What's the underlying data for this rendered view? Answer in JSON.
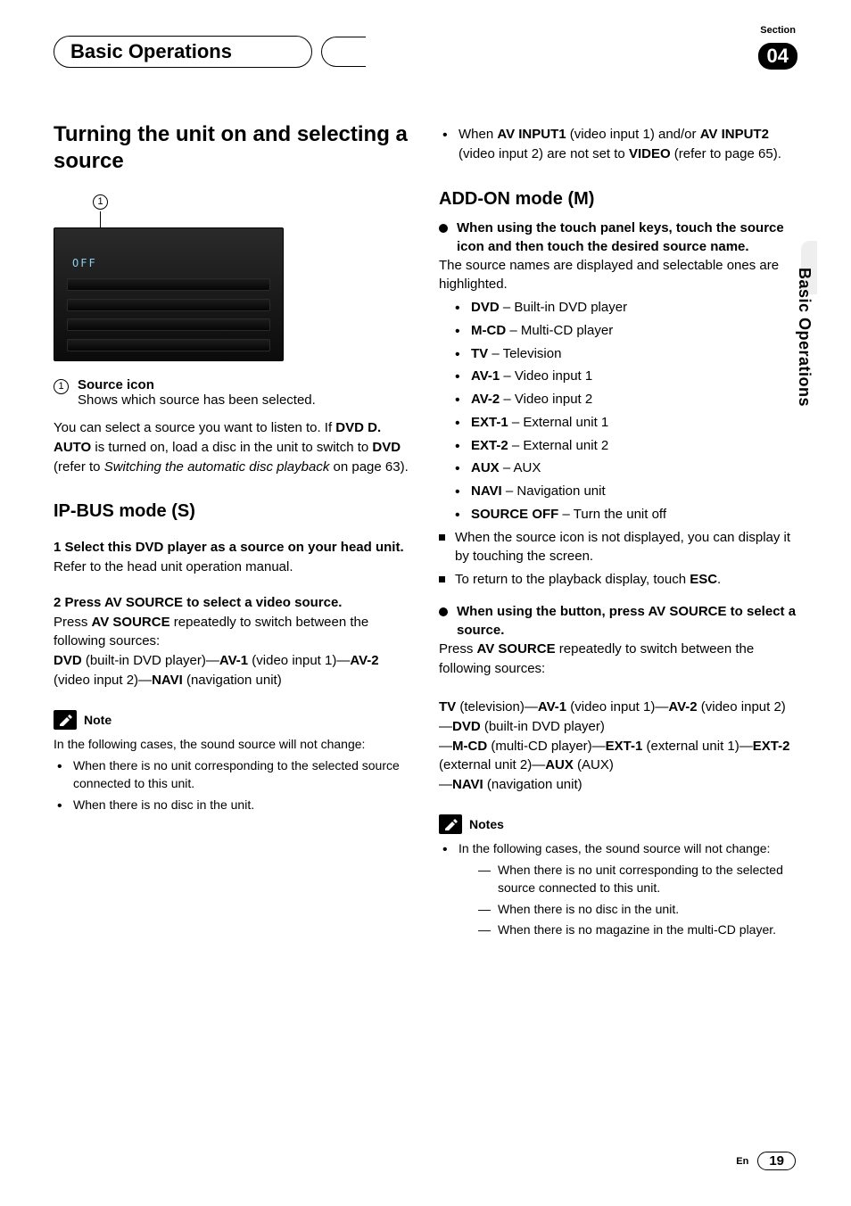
{
  "header": {
    "title": "Basic Operations",
    "section_label": "Section",
    "section_number": "04",
    "side_label": "Basic Operations"
  },
  "left": {
    "h1": "Turning the unit on and selecting a source",
    "callout_number": "1",
    "device_off_text": "OFF",
    "source_icon_label": "Source icon",
    "source_icon_desc": "Shows which source has been selected.",
    "intro_p1a": "You can select a source you want to listen to. If ",
    "intro_p1_bold1": "DVD D. AUTO",
    "intro_p1b": " is turned on, load a disc in the unit to switch to ",
    "intro_p1_bold2": "DVD",
    "intro_p1c": " (refer to ",
    "intro_p1_ital": "Switching the automatic disc playback",
    "intro_p1d": " on page 63).",
    "h2_ipbus": "IP-BUS mode (S)",
    "step1_head": "1    Select this DVD player as a source on your head unit.",
    "step1_body": "Refer to the head unit operation manual.",
    "step2_head": "2    Press AV SOURCE to select a video source.",
    "step2_body_a": "Press ",
    "step2_body_bold": "AV SOURCE",
    "step2_body_b": " repeatedly to switch between the following sources:",
    "seq_a1": "DVD",
    "seq_a1d": " (built-in DVD player)—",
    "seq_a2": "AV-1",
    "seq_a2d": " (video input 1)—",
    "seq_a3": "AV-2",
    "seq_a3d": " (video input 2)—",
    "seq_a4": "NAVI",
    "seq_a4d": " (navigation unit)",
    "note_title": "Note",
    "note_intro": "In the following cases, the sound source will not change:",
    "note_b1": "When there is no unit corresponding to the selected source connected to this unit.",
    "note_b2": "When there is no disc in the unit."
  },
  "right": {
    "top_b1a": "When ",
    "top_b1b": "AV INPUT1",
    "top_b1c": " (video input 1) and/or ",
    "top_b1d": "AV INPUT2",
    "top_b1e": " (video input 2) are not set to ",
    "top_b1f": "VIDEO",
    "top_b1g": " (refer to page 65).",
    "h2_addon": "ADD-ON mode (M)",
    "touch_head": "When using the touch panel keys, touch the source icon and then touch the desired source name.",
    "touch_body": "The source names are displayed and selectable ones are highlighted.",
    "src": [
      {
        "k": "DVD",
        "v": " – Built-in DVD player"
      },
      {
        "k": "M-CD",
        "v": " – Multi-CD player"
      },
      {
        "k": "TV",
        "v": " – Television"
      },
      {
        "k": "AV-1",
        "v": " – Video input 1"
      },
      {
        "k": "AV-2",
        "v": " – Video input 2"
      },
      {
        "k": "EXT-1",
        "v": " – External unit 1"
      },
      {
        "k": "EXT-2",
        "v": " – External unit 2"
      },
      {
        "k": "AUX",
        "v": " – AUX"
      },
      {
        "k": "NAVI",
        "v": " – Navigation unit"
      },
      {
        "k": "SOURCE OFF",
        "v": " – Turn the unit off"
      }
    ],
    "sq1": "When the source icon is not displayed, you can display it by touching the screen.",
    "sq2a": "To return to the playback display, touch ",
    "sq2b": "ESC",
    "sq2c": ".",
    "btn_head": "When using the button, press AV SOURCE to select a source.",
    "btn_body_a": "Press ",
    "btn_body_bold": "AV SOURCE",
    "btn_body_b": " repeatedly to switch between the following sources:",
    "seq_b1": "TV",
    "seq_b1d": " (television)—",
    "seq_b2": "AV-1",
    "seq_b2d": " (video input 1)—",
    "seq_b3": "AV-2",
    "seq_b3d": " (video input 2)—",
    "seq_b4": "DVD",
    "seq_b4d": " (built-in DVD player)\n—",
    "seq_b5": "M-CD",
    "seq_b5d": " (multi-CD player)—",
    "seq_b6": "EXT-1",
    "seq_b6d": " (external unit 1)—",
    "seq_b7": "EXT-2",
    "seq_b7d": " (external unit 2)—",
    "seq_b8": "AUX",
    "seq_b8d": " (AUX)\n—",
    "seq_b9": "NAVI",
    "seq_b9d": " (navigation unit)",
    "notes_title": "Notes",
    "notes_intro": "In the following cases, the sound source will not change:",
    "notes_d1": "When there is no unit corresponding to the selected source connected to this unit.",
    "notes_d2": "When there is no disc in the unit.",
    "notes_d3": "When there is no magazine in the multi-CD player."
  },
  "footer": {
    "lang": "En",
    "page": "19"
  }
}
